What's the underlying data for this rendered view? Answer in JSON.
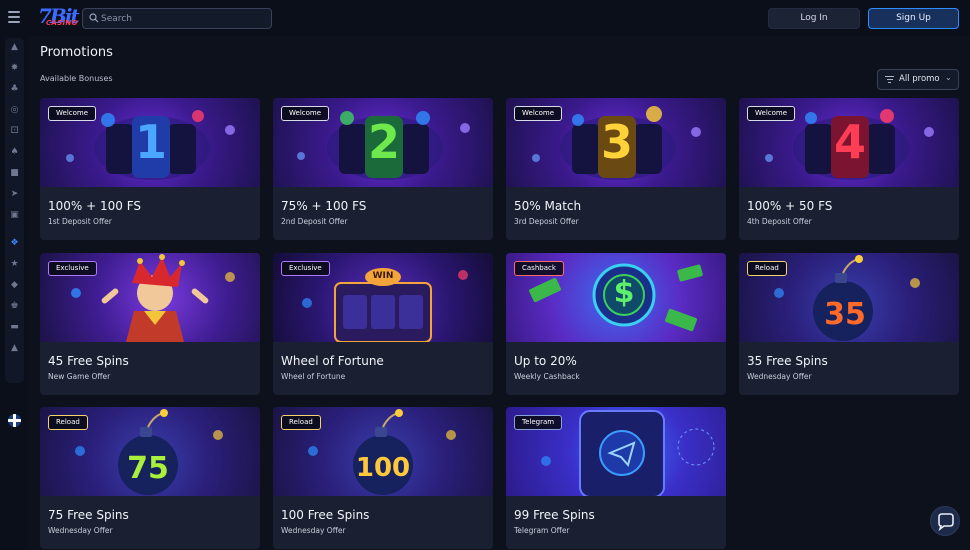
{
  "header": {
    "logo_text": "7BIT CASINO",
    "search_placeholder": "Search",
    "login_label": "Log In",
    "signup_label": "Sign Up"
  },
  "sidebar": {
    "icons": [
      "flame-icon",
      "puzzle-icon",
      "cherries-icon",
      "roulette-icon",
      "dice-icon",
      "cards-icon",
      "jackpot-icon",
      "rocket-icon",
      "live-icon",
      "gift-icon",
      "trophy-icon",
      "vip-icon",
      "crown-icon",
      "ticket-icon",
      "tournament-icon",
      "language-flag-icon"
    ],
    "active": "gift-icon"
  },
  "page": {
    "title": "Promotions",
    "subtitle": "Available Bonuses",
    "filter_label": "All promo"
  },
  "colors": {
    "background": "#0d111c",
    "card": "#1a2031",
    "accent": "#2f8cff"
  },
  "promos": [
    {
      "tag": "Welcome",
      "title": "100% + 100 FS",
      "subtitle": "1st Deposit Offer",
      "art_text": "1"
    },
    {
      "tag": "Welcome",
      "title": "75% + 100 FS",
      "subtitle": "2nd Deposit Offer",
      "art_text": "2"
    },
    {
      "tag": "Welcome",
      "title": "50% Match",
      "subtitle": "3rd Deposit Offer",
      "art_text": "3"
    },
    {
      "tag": "Welcome",
      "title": "100% + 50 FS",
      "subtitle": "4th Deposit Offer",
      "art_text": "4"
    },
    {
      "tag": "Exclusive",
      "title": "45 Free Spins",
      "subtitle": "New Game Offer",
      "art_text": ""
    },
    {
      "tag": "Exclusive",
      "title": "Wheel of Fortune",
      "subtitle": "Wheel of Fortune",
      "art_text": "WIN"
    },
    {
      "tag": "Cashback",
      "title": "Up to 20%",
      "subtitle": "Weekly Cashback",
      "art_text": "$"
    },
    {
      "tag": "Reload",
      "title": "35 Free Spins",
      "subtitle": "Wednesday Offer",
      "art_text": "35"
    },
    {
      "tag": "Reload",
      "title": "75 Free Spins",
      "subtitle": "Wednesday Offer",
      "art_text": "75"
    },
    {
      "tag": "Reload",
      "title": "100 Free Spins",
      "subtitle": "Wednesday Offer",
      "art_text": "100"
    },
    {
      "tag": "Telegram",
      "title": "99 Free Spins",
      "subtitle": "Telegram Offer",
      "art_text": ""
    }
  ]
}
